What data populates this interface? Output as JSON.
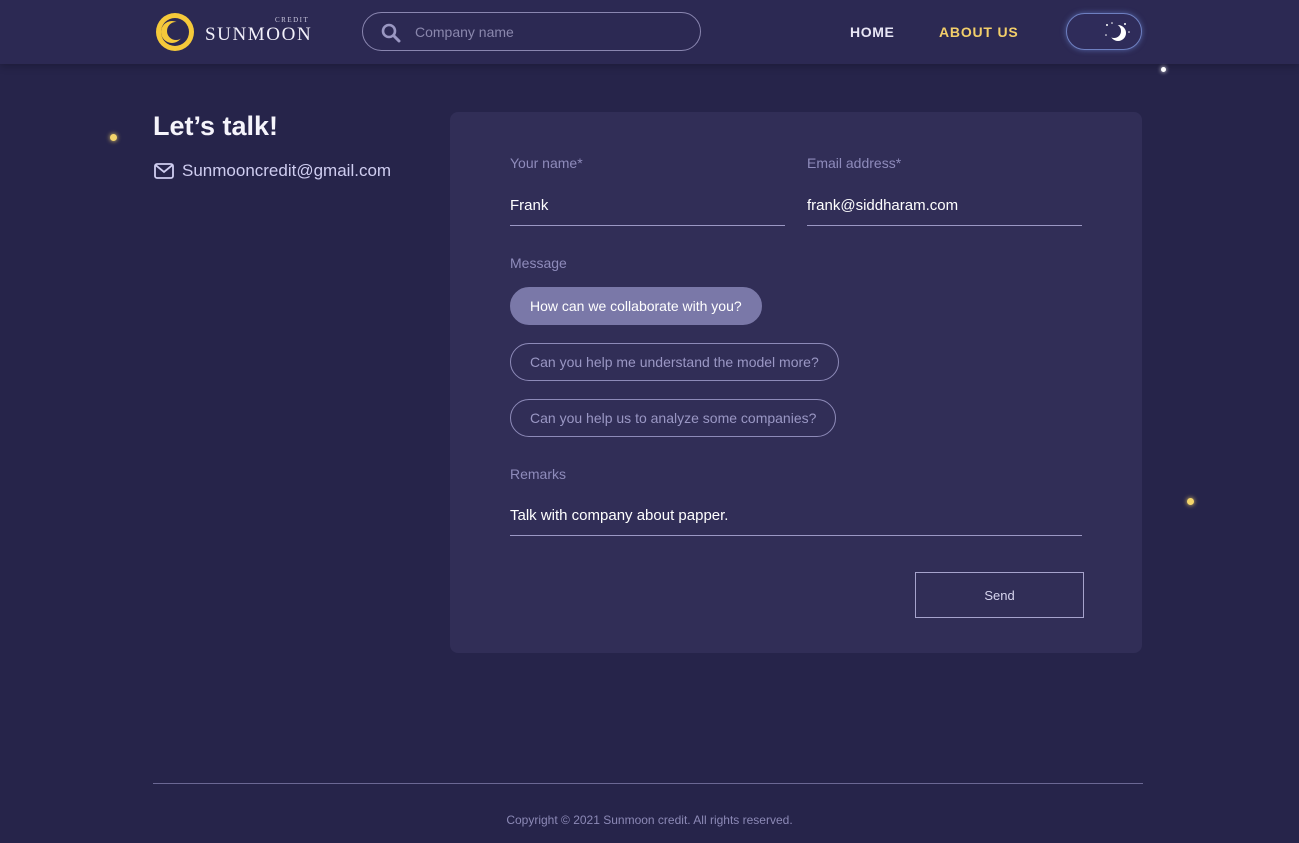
{
  "header": {
    "logo": {
      "small_text": "CREDIT",
      "wordmark": "SUNMOON"
    },
    "search": {
      "placeholder": "Company name",
      "value": ""
    },
    "nav": {
      "home": "HOME",
      "about": "ABOUT US"
    },
    "theme_toggle": {
      "state": "dark",
      "icon": "moon-stars-icon"
    }
  },
  "contact": {
    "heading": "Let’s talk!",
    "email": "Sunmooncredit@gmail.com",
    "icon": "mail-icon"
  },
  "form": {
    "name": {
      "label": "Your name*",
      "value": "Frank"
    },
    "email": {
      "label": "Email address*",
      "value": "frank@siddharam.com"
    },
    "message": {
      "label": "Message",
      "options": [
        {
          "text": "How can we collaborate with you?",
          "selected": true
        },
        {
          "text": "Can you help me understand the model more?",
          "selected": false
        },
        {
          "text": "Can you help us to analyze some companies?",
          "selected": false
        }
      ]
    },
    "remarks": {
      "label": "Remarks",
      "value": "Talk with company about papper."
    },
    "send_label": "Send"
  },
  "footer": {
    "copyright": "Copyright © 2021 Sunmoon credit. All rights reserved."
  },
  "colors": {
    "background": "#26244a",
    "header": "#2c2953",
    "card": "#312e57",
    "accent_gold": "#f3cf6a",
    "chip_selected": "#7a78a8",
    "label": "#8e8bbb"
  }
}
